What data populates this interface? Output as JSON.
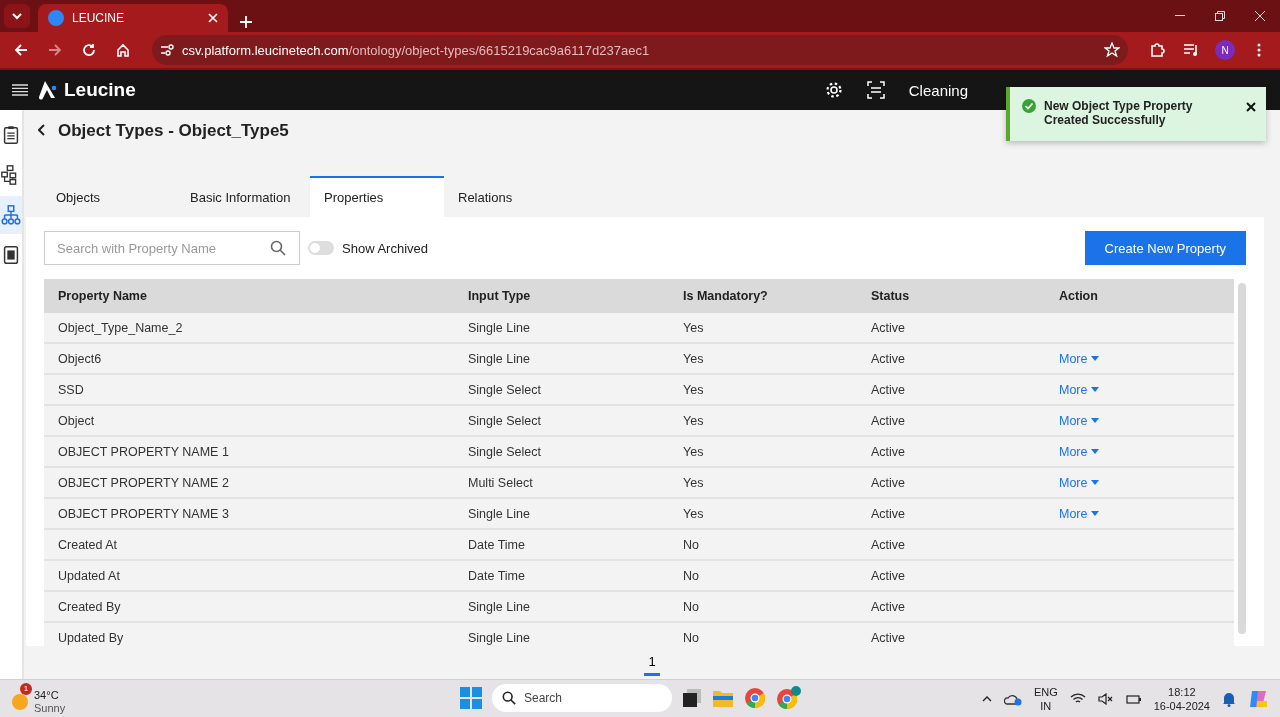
{
  "browser": {
    "tab_title": "LEUCINE",
    "url_host": "csv.platform.leucinetech.com",
    "url_path": "/ontology/object-types/6615219cac9a6117d237aec1",
    "profile": "N"
  },
  "app": {
    "brand": "Leucine",
    "header_item": "Cleaning"
  },
  "sidebar": [
    {
      "selected": false
    },
    {
      "selected": false
    },
    {
      "selected": true
    },
    {
      "selected": false
    }
  ],
  "page": {
    "title": "Object Types - Object_Type5"
  },
  "tabs": [
    {
      "label": "Objects",
      "selected": false
    },
    {
      "label": "Basic Information",
      "selected": false
    },
    {
      "label": "Properties",
      "selected": true
    },
    {
      "label": "Relations",
      "selected": false
    }
  ],
  "search": {
    "placeholder": "Search with Property Name"
  },
  "show_archived": {
    "label": "Show Archived",
    "on": false
  },
  "create_button": "Create New Property",
  "table": {
    "columns": [
      "Property Name",
      "Input Type",
      "Is Mandatory?",
      "Status",
      "Action"
    ],
    "rows": [
      {
        "name": "Object_Type_Name_2",
        "input": "Single Line",
        "mandatory": "Yes",
        "status": "Active"
      },
      {
        "name": "Object6",
        "input": "Single Line",
        "mandatory": "Yes",
        "status": "Active",
        "action": "More"
      },
      {
        "name": "SSD",
        "input": "Single Select",
        "mandatory": "Yes",
        "status": "Active",
        "action": "More"
      },
      {
        "name": "Object",
        "input": "Single Select",
        "mandatory": "Yes",
        "status": "Active",
        "action": "More"
      },
      {
        "name": "OBJECT PROPERTY NAME 1",
        "input": "Single Select",
        "mandatory": "Yes",
        "status": "Active",
        "action": "More"
      },
      {
        "name": "OBJECT PROPERTY NAME 2",
        "input": "Multi Select",
        "mandatory": "Yes",
        "status": "Active",
        "action": "More"
      },
      {
        "name": "OBJECT PROPERTY NAME 3",
        "input": "Single Line",
        "mandatory": "Yes",
        "status": "Active",
        "action": "More"
      },
      {
        "name": "Created At",
        "input": "Date Time",
        "mandatory": "No",
        "status": "Active"
      },
      {
        "name": "Updated At",
        "input": "Date Time",
        "mandatory": "No",
        "status": "Active"
      },
      {
        "name": "Created By",
        "input": "Single Line",
        "mandatory": "No",
        "status": "Active"
      },
      {
        "name": "Updated By",
        "input": "Single Line",
        "mandatory": "No",
        "status": "Active"
      }
    ]
  },
  "pagination": [
    {
      "label": "1",
      "selected": true
    }
  ],
  "toast": {
    "message": "New Object Type Property Created Successfully"
  },
  "taskbar": {
    "temperature": "34°C",
    "weather": "Sunny",
    "weather_badge": "1",
    "search": "Search",
    "language": "ENG",
    "region": "IN",
    "time": "18:12",
    "date": "16-04-2024"
  }
}
